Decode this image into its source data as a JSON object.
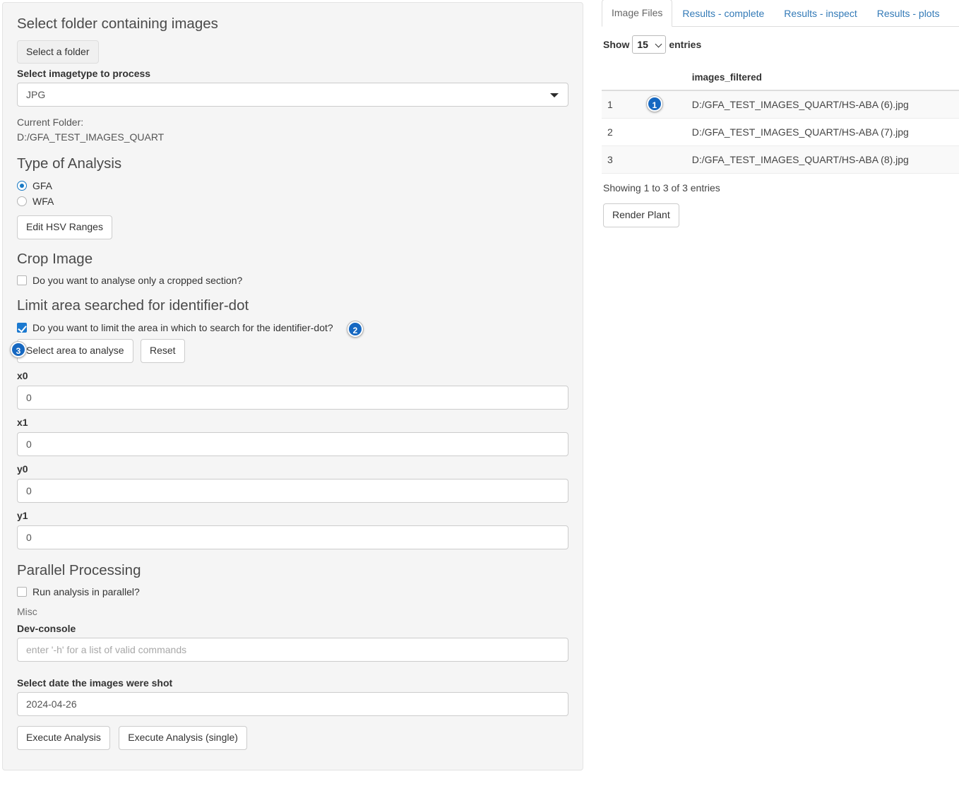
{
  "left": {
    "folder_section_title": "Select folder containing images",
    "select_folder_button": "Select a folder",
    "imagetype_label": "Select imagetype to process",
    "imagetype_value": "JPG",
    "imagetype_options": [
      "JPG"
    ],
    "current_folder_label": "Current Folder:",
    "current_folder_value": "D:/GFA_TEST_IMAGES_QUART",
    "analysis_section_title": "Type of Analysis",
    "analysis_options": [
      {
        "label": "GFA",
        "selected": true
      },
      {
        "label": "WFA",
        "selected": false
      }
    ],
    "edit_hsv_button": "Edit HSV Ranges",
    "crop_section_title": "Crop Image",
    "crop_checkbox_label": "Do you want to analyse only a cropped section?",
    "crop_checkbox_checked": false,
    "limit_section_title": "Limit area searched for identifier-dot",
    "limit_checkbox_label": "Do you want to limit the area in which to search for the identifier-dot?",
    "limit_checkbox_checked": true,
    "select_area_button": "Select area to analyse",
    "reset_button": "Reset",
    "coords": [
      {
        "label": "x0",
        "value": "0"
      },
      {
        "label": "x1",
        "value": "0"
      },
      {
        "label": "y0",
        "value": "0"
      },
      {
        "label": "y1",
        "value": "0"
      }
    ],
    "parallel_section_title": "Parallel Processing",
    "parallel_checkbox_label": "Run analysis in parallel?",
    "parallel_checkbox_checked": false,
    "misc_label": "Misc",
    "dev_console_label": "Dev-console",
    "dev_console_placeholder": "enter '-h' for a list of valid commands",
    "dev_console_value": "",
    "date_label": "Select date the images were shot",
    "date_value": "2024-04-26",
    "execute_button": "Execute Analysis",
    "execute_single_button": "Execute Analysis (single)"
  },
  "right": {
    "tabs": [
      {
        "label": "Image Files",
        "active": true
      },
      {
        "label": "Results - complete",
        "active": false
      },
      {
        "label": "Results - inspect",
        "active": false
      },
      {
        "label": "Results - plots",
        "active": false
      }
    ],
    "show_prefix": "Show",
    "show_value": "15",
    "show_options": [
      "15"
    ],
    "show_suffix": "entries",
    "table": {
      "headers": [
        "",
        "",
        "images_filtered"
      ],
      "rows": [
        {
          "index": "1",
          "path": "D:/GFA_TEST_IMAGES_QUART/HS-ABA (6).jpg"
        },
        {
          "index": "2",
          "path": "D:/GFA_TEST_IMAGES_QUART/HS-ABA (7).jpg"
        },
        {
          "index": "3",
          "path": "D:/GFA_TEST_IMAGES_QUART/HS-ABA (8).jpg"
        }
      ]
    },
    "showing_text": "Showing 1 to 3 of 3 entries",
    "render_plant_button": "Render Plant"
  },
  "badges": {
    "one": "1",
    "two": "2",
    "three": "3"
  },
  "colors": {
    "accent": "#1668c1",
    "link": "#337ab7",
    "panel_bg": "#f5f5f5",
    "checkbox_on": "#1b79d0"
  }
}
